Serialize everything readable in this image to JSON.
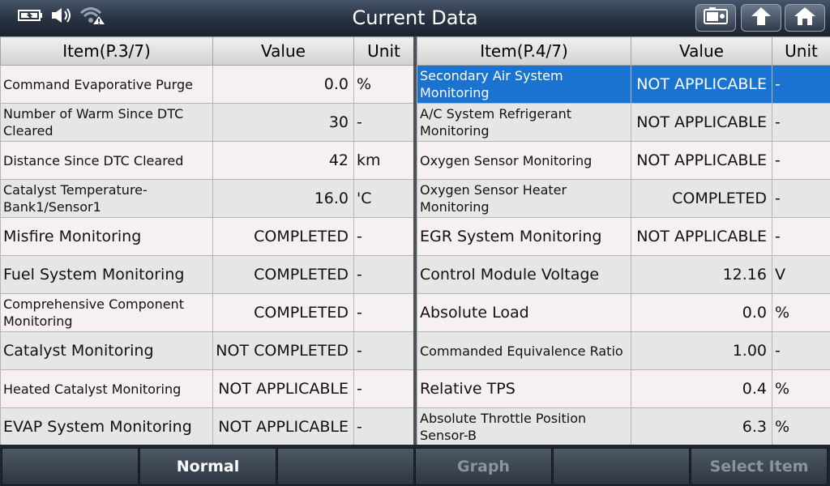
{
  "header": {
    "title": "Current Data",
    "status_icons": [
      "battery-icon",
      "speaker-icon",
      "wifi-warning-icon"
    ],
    "buttons": [
      "camera-icon",
      "up-arrow-icon",
      "home-icon"
    ]
  },
  "left_table": {
    "headers": {
      "item": "Item(P.3/7)",
      "value": "Value",
      "unit": "Unit"
    },
    "rows": [
      {
        "item": "Command Evaporative Purge",
        "value": "0.0",
        "unit": "%"
      },
      {
        "item": "Number of Warm Since DTC Cleared",
        "value": "30",
        "unit": "-"
      },
      {
        "item": "Distance Since DTC Cleared",
        "value": "42",
        "unit": "km"
      },
      {
        "item": "Catalyst Temperature-Bank1/Sensor1",
        "value": "16.0",
        "unit": "'C"
      },
      {
        "item": "Misfire Monitoring",
        "value": "COMPLETED",
        "unit": "-"
      },
      {
        "item": "Fuel System Monitoring",
        "value": "COMPLETED",
        "unit": "-"
      },
      {
        "item": "Comprehensive Component Monitoring",
        "value": "COMPLETED",
        "unit": "-"
      },
      {
        "item": "Catalyst Monitoring",
        "value": "NOT COMPLETED",
        "unit": "-"
      },
      {
        "item": "Heated Catalyst Monitoring",
        "value": "NOT APPLICABLE",
        "unit": "-"
      },
      {
        "item": "EVAP System Monitoring",
        "value": "NOT APPLICABLE",
        "unit": "-"
      }
    ]
  },
  "right_table": {
    "headers": {
      "item": "Item(P.4/7)",
      "value": "Value",
      "unit": "Unit"
    },
    "rows": [
      {
        "item": "Secondary Air System Monitoring",
        "value": "NOT APPLICABLE",
        "unit": "-"
      },
      {
        "item": "A/C System Refrigerant Monitoring",
        "value": "NOT APPLICABLE",
        "unit": "-"
      },
      {
        "item": "Oxygen Sensor Monitoring",
        "value": "NOT APPLICABLE",
        "unit": "-"
      },
      {
        "item": "Oxygen Sensor Heater Monitoring",
        "value": "COMPLETED",
        "unit": "-"
      },
      {
        "item": "EGR System Monitoring",
        "value": "NOT APPLICABLE",
        "unit": "-"
      },
      {
        "item": "Control Module Voltage",
        "value": "12.16",
        "unit": "V"
      },
      {
        "item": "Absolute Load",
        "value": "0.0",
        "unit": "%"
      },
      {
        "item": "Commanded Equivalence Ratio",
        "value": "1.00",
        "unit": "-"
      },
      {
        "item": "Relative TPS",
        "value": "0.4",
        "unit": "%"
      },
      {
        "item": "Absolute Throttle Position Sensor-B",
        "value": "6.3",
        "unit": "%"
      }
    ]
  },
  "bottom": {
    "buttons": [
      "",
      "Normal",
      "",
      "Graph",
      "",
      "Select Item"
    ]
  },
  "colors": {
    "selected_row": "#1a73d0"
  }
}
